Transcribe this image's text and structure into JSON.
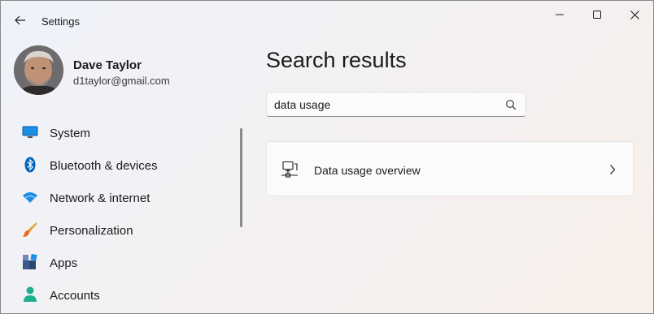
{
  "window": {
    "title": "Settings",
    "controls": [
      "minimize-icon",
      "maximize-icon",
      "close-icon"
    ]
  },
  "profile": {
    "name": "Dave Taylor",
    "email": "d1taylor@gmail.com"
  },
  "sidebar": {
    "items": [
      {
        "label": "System",
        "icon": "monitor-icon",
        "color": "#0078d4"
      },
      {
        "label": "Bluetooth & devices",
        "icon": "bluetooth-icon",
        "color": "#0067c0"
      },
      {
        "label": "Network & internet",
        "icon": "wifi-icon",
        "color": "#1a8fe3"
      },
      {
        "label": "Personalization",
        "icon": "brush-icon",
        "color": "#e66b1e"
      },
      {
        "label": "Apps",
        "icon": "apps-icon",
        "color": "#3a5a8c"
      },
      {
        "label": "Accounts",
        "icon": "person-icon",
        "color": "#1fae8f"
      }
    ]
  },
  "main": {
    "title": "Search results",
    "search": {
      "value": "data usage"
    },
    "results": [
      {
        "label": "Data usage overview",
        "icon": "network-pc-icon"
      }
    ]
  },
  "colors": {
    "accent": "#0067c0",
    "background_start": "#eef2f9",
    "background_end": "#f8efe9"
  }
}
